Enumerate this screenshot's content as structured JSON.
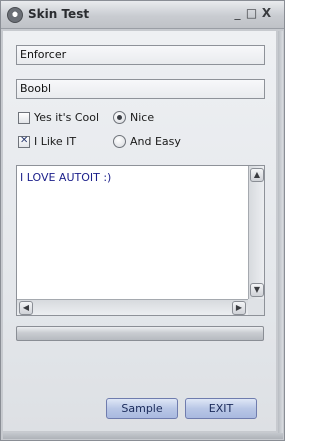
{
  "window": {
    "title": "Skin Test",
    "controls": {
      "minimize": "_",
      "maximize": "□",
      "close": "X"
    }
  },
  "fields": {
    "input1_value": "Enforcer",
    "input2_value": "Boobl"
  },
  "options": {
    "checkbox1": {
      "label": "Yes it's Cool",
      "checked": false
    },
    "checkbox2": {
      "label": "I Like IT",
      "checked": true
    },
    "radio1": {
      "label": "Nice",
      "selected": true
    },
    "radio2": {
      "label": "And Easy",
      "selected": false
    }
  },
  "editbox": {
    "text": "I LOVE AUTOIT :)"
  },
  "scrollbar_icons": {
    "up": "▲",
    "down": "▼",
    "left": "◀",
    "right": "▶"
  },
  "progress": {
    "value": 0
  },
  "buttons": {
    "sample_label": "Sample",
    "exit_label": "EXIT"
  }
}
